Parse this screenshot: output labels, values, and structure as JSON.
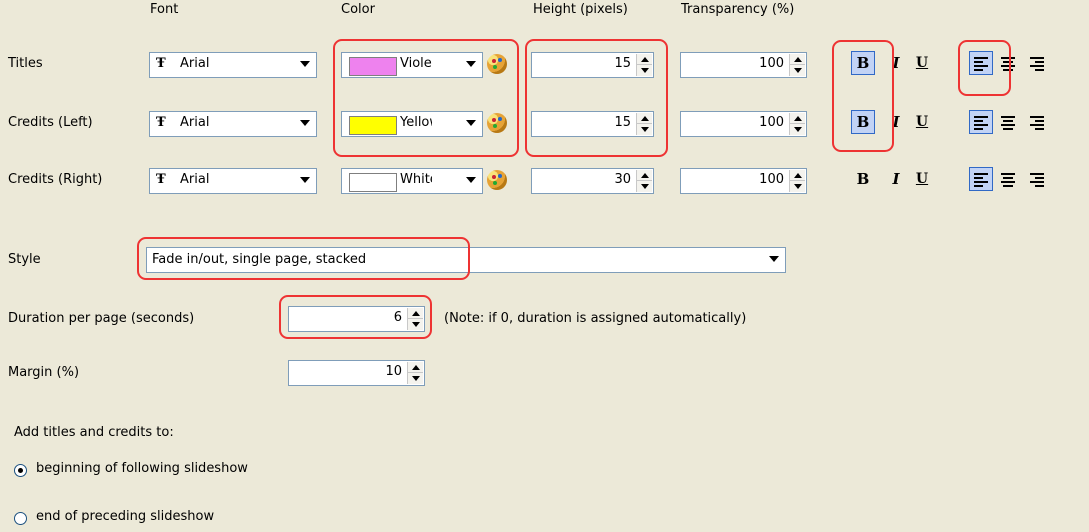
{
  "headers": {
    "font": "Font",
    "color": "Color",
    "height": "Height (pixels)",
    "transparency": "Transparency (%)"
  },
  "rows": [
    {
      "label": "Titles",
      "font": "Arial",
      "color_name": "Violet",
      "color_hex": "#ee82ee",
      "height": "15",
      "transparency": "100",
      "bold": true,
      "align": "left"
    },
    {
      "label": "Credits (Left)",
      "font": "Arial",
      "color_name": "Yellow",
      "color_hex": "#ffff00",
      "height": "15",
      "transparency": "100",
      "bold": true,
      "align": "left"
    },
    {
      "label": "Credits (Right)",
      "font": "Arial",
      "color_name": "White",
      "color_hex": "#ffffff",
      "height": "30",
      "transparency": "100",
      "bold": false,
      "align": "left"
    }
  ],
  "format_glyphs": {
    "bold": "B",
    "italic": "I",
    "underline": "U"
  },
  "font_icon": "Ŧ",
  "style": {
    "label": "Style",
    "value": "Fade in/out, single page, stacked"
  },
  "duration": {
    "label": "Duration per page (seconds)",
    "value": "6",
    "note": "(Note: if 0, duration is assigned automatically)"
  },
  "margin": {
    "label": "Margin (%)",
    "value": "10"
  },
  "add_to": {
    "label": "Add titles and credits to:",
    "options": [
      {
        "label": "beginning of following slideshow",
        "selected": true
      },
      {
        "label": "end of preceding slideshow",
        "selected": false
      }
    ]
  },
  "colors": {
    "background": "#ece9d8",
    "highlight": "#e33333",
    "field_border": "#7f9db9",
    "toggle_on": "#c2d3f5"
  }
}
